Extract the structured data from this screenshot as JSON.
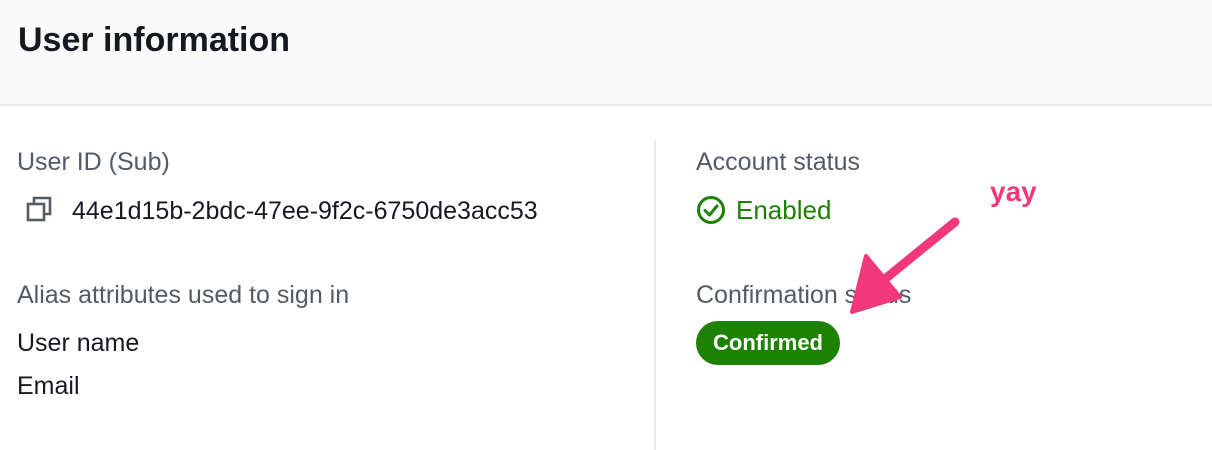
{
  "panel": {
    "title": "User information"
  },
  "user_id": {
    "label": "User ID (Sub)",
    "value": "44e1d15b-2bdc-47ee-9f2c-6750de3acc53",
    "copy_icon": "copy-icon"
  },
  "alias": {
    "label": "Alias attributes used to sign in",
    "items": [
      "User name",
      "Email"
    ]
  },
  "account_status": {
    "label": "Account status",
    "value": "Enabled",
    "icon": "check-circle-icon",
    "color": "#1d8102"
  },
  "confirmation_status": {
    "label": "Confirmation status",
    "value": "Confirmed",
    "color": "#1d8102"
  },
  "annotation": {
    "text": "yay",
    "color": "#f0387b",
    "arrow_icon": "arrow-icon"
  }
}
